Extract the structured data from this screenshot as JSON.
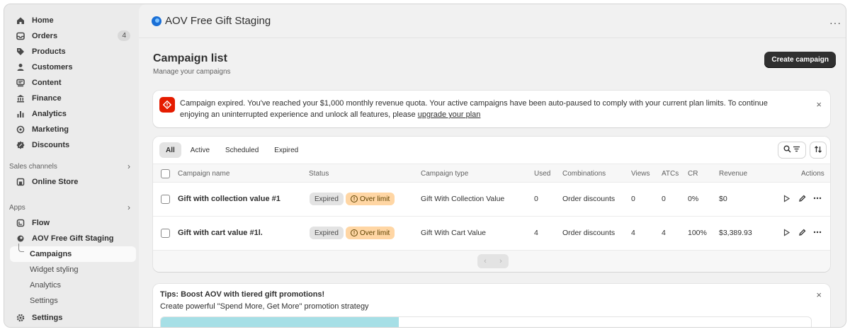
{
  "sidebar": {
    "items": [
      {
        "label": "Home",
        "icon": "home-icon"
      },
      {
        "label": "Orders",
        "icon": "orders-icon",
        "badge": "4"
      },
      {
        "label": "Products",
        "icon": "tag-icon"
      },
      {
        "label": "Customers",
        "icon": "person-icon"
      },
      {
        "label": "Content",
        "icon": "content-icon"
      },
      {
        "label": "Finance",
        "icon": "bank-icon"
      },
      {
        "label": "Analytics",
        "icon": "bar-chart-icon"
      },
      {
        "label": "Marketing",
        "icon": "target-icon"
      },
      {
        "label": "Discounts",
        "icon": "discount-icon"
      }
    ],
    "sales_channels_label": "Sales channels",
    "online_store_label": "Online Store",
    "apps_label": "Apps",
    "flow_label": "Flow",
    "app_label": "AOV Free Gift Staging",
    "app_sub": [
      "Campaigns",
      "Widget styling",
      "Analytics",
      "Settings"
    ],
    "settings_label": "Settings"
  },
  "topbar": {
    "title": "AOV Free Gift Staging",
    "more": "···"
  },
  "page": {
    "title": "Campaign list",
    "subtitle": "Manage your campaigns",
    "create_label": "Create campaign"
  },
  "banner": {
    "text": "Campaign expired. You've reached your $1,000 monthly revenue quota. Your active campaigns have been auto-paused to comply with your current plan limits. To continue enjoying an uninterrupted experience and unlock all features, please ",
    "link": "upgrade your plan",
    "close": "×"
  },
  "tabs": [
    "All",
    "Active",
    "Scheduled",
    "Expired"
  ],
  "table": {
    "headers": [
      "Campaign name",
      "Status",
      "Campaign type",
      "Used",
      "Combinations",
      "Views",
      "ATCs",
      "CR",
      "Revenue",
      "Actions"
    ],
    "rows": [
      {
        "name": "Gift with collection value #1",
        "status": "Expired",
        "limit": "Over limit",
        "type": "Gift With Collection Value",
        "used": "0",
        "combinations": "Order discounts",
        "views": "0",
        "atcs": "0",
        "cr": "0%",
        "revenue": "$0"
      },
      {
        "name": "Gift with cart value #1l.",
        "status": "Expired",
        "limit": "Over limit",
        "type": "Gift With Cart Value",
        "used": "4",
        "combinations": "Order discounts",
        "views": "4",
        "atcs": "4",
        "cr": "100%",
        "revenue": "$3,389.93"
      }
    ]
  },
  "tips": {
    "title": "Tips: Boost AOV with tiered gift promotions!",
    "subtitle": "Create powerful \"Spend More, Get More\" promotion strategy",
    "close": "×"
  }
}
